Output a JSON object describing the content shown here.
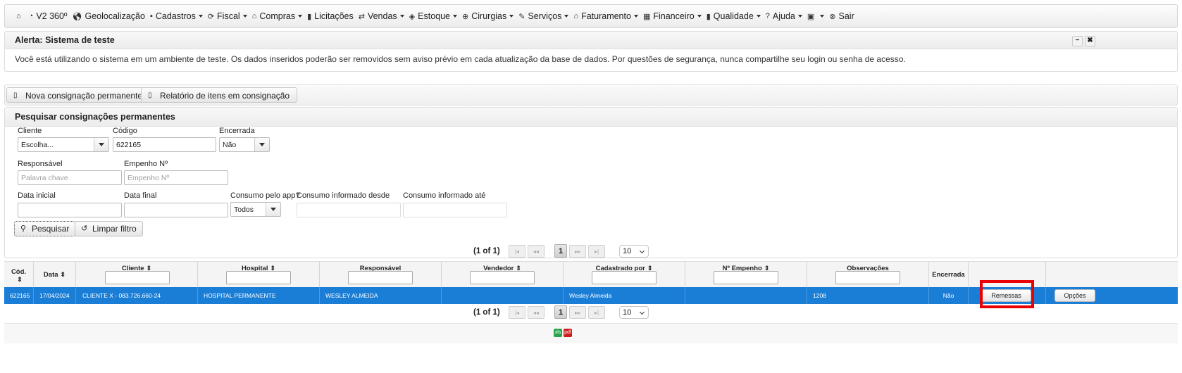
{
  "menu": [
    {
      "icon": "home-icon",
      "glyph": "⌂",
      "label": "",
      "dropdown": false
    },
    {
      "icon": "pie-icon",
      "glyph": "◔",
      "label": "V2 360º",
      "dropdown": false
    },
    {
      "icon": "globe-icon",
      "glyph": "🌎︎",
      "label": "Geolocalização",
      "dropdown": false
    },
    {
      "icon": "save-icon",
      "glyph": "▪",
      "label": "Cadastros",
      "dropdown": true
    },
    {
      "icon": "refresh-icon",
      "glyph": "⟳",
      "label": "Fiscal",
      "dropdown": true
    },
    {
      "icon": "bank-icon",
      "glyph": "⌂",
      "label": "Compras",
      "dropdown": true
    },
    {
      "icon": "book-icon",
      "glyph": "▮",
      "label": "Licitações",
      "dropdown": false
    },
    {
      "icon": "transfer-icon",
      "glyph": "⇄",
      "label": "Vendas",
      "dropdown": true
    },
    {
      "icon": "tag-icon",
      "glyph": "◈",
      "label": "Estoque",
      "dropdown": true
    },
    {
      "icon": "plus-circle-icon",
      "glyph": "⊕",
      "label": "Cirurgias",
      "dropdown": true
    },
    {
      "icon": "wrench-icon",
      "glyph": "✎",
      "label": "Serviços",
      "dropdown": true
    },
    {
      "icon": "bank-icon",
      "glyph": "⌂",
      "label": "Faturamento",
      "dropdown": true
    },
    {
      "icon": "calculator-icon",
      "glyph": "▦",
      "label": "Financeiro",
      "dropdown": true
    },
    {
      "icon": "book-icon",
      "glyph": "▮",
      "label": "Qualidade",
      "dropdown": true
    },
    {
      "icon": "help-icon",
      "glyph": "?",
      "label": "Ajuda",
      "dropdown": true
    },
    {
      "icon": "user-settings-icon",
      "glyph": "▣",
      "label": "",
      "dropdown": true
    },
    {
      "icon": "close-circle-icon",
      "glyph": "⊗",
      "label": "Sair",
      "dropdown": false
    }
  ],
  "alert": {
    "title": "Alerta: Sistema de teste",
    "text": "Você está utilizando o sistema em um ambiente de teste. Os dados inseridos poderão ser removidos sem aviso prévio em cada atualização da base de dados. Por questões de segurança, nunca compartilhe seu login ou senha de acesso.",
    "minimize": "−",
    "close": "✖"
  },
  "toolbar": {
    "new_label": "Nova consignação permanente",
    "report_label": "Relatório de itens em consignação"
  },
  "search": {
    "title": "Pesquisar consignações permanentes",
    "cliente_label": "Cliente",
    "cliente_value": "Escolha...",
    "codigo_label": "Código",
    "codigo_value": "622165",
    "encerrada_label": "Encerrada",
    "encerrada_value": "Não",
    "responsavel_label": "Responsável",
    "responsavel_placeholder": "Palavra chave",
    "empenho_label": "Empenho Nº",
    "empenho_placeholder": "Empenho Nº",
    "data_inicial_label": "Data inicial",
    "data_final_label": "Data final",
    "consumo_app_label": "Consumo pelo app?",
    "consumo_app_value": "Todos",
    "consumo_desde_label": "Consumo informado desde",
    "consumo_ate_label": "Consumo informado até",
    "search_button": "Pesquisar",
    "clear_button": "Limpar filtro"
  },
  "pager": {
    "status": "(1 of 1)",
    "first": "|◂",
    "prev": "◂◂",
    "page": "1",
    "next": "▸▸",
    "last": "▸|",
    "rows": "10"
  },
  "table": {
    "columns": [
      "Cód.",
      "Data",
      "Cliente",
      "Hospital",
      "Responsável",
      "Vendedor",
      "Cadastrado por",
      "Nº Empenho",
      "Observações",
      "Encerrada",
      "",
      ""
    ],
    "row": {
      "cod": "622165",
      "data": "17/04/2024",
      "cliente": "CLIENTE X - 083.726.660-24",
      "hospital": "HOSPITAL PERMANENTE",
      "responsavel": "WESLEY ALMEIDA",
      "vendedor": "",
      "cadastrado_por": "Wesley Almeida",
      "empenho": "",
      "observacoes": "1208",
      "encerrada": "Não",
      "remessas_button": "Remessas",
      "opcoes_button": "Opções"
    }
  },
  "export": {
    "excel_label": "xls",
    "pdf_label": "pdf",
    "excel_color": "#2aa34a",
    "pdf_color": "#d11a1a"
  },
  "colors": {
    "selected_row": "#1a7ed6",
    "highlight": "#ea0000"
  }
}
